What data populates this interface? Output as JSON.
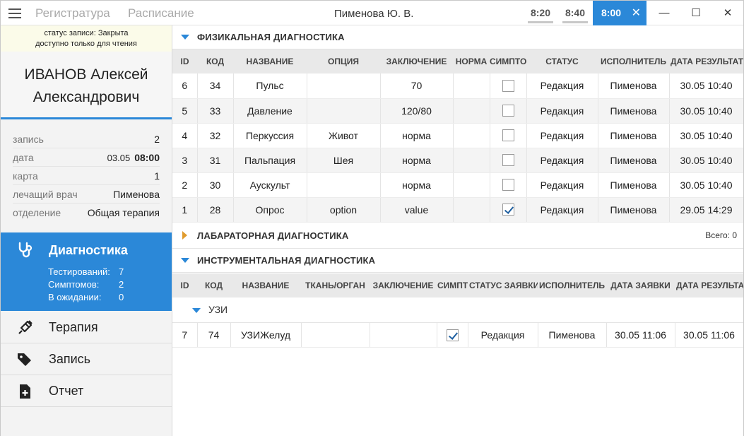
{
  "titlebar": {
    "nav": [
      "Регистратура",
      "Расписание"
    ],
    "user": "Пименова Ю. В.",
    "times": [
      "8:20",
      "8:40",
      "8:00"
    ],
    "close_tab": "✕",
    "minimize": "—",
    "maximize": "☐",
    "close": "✕"
  },
  "sidebar": {
    "status_line1": "статус записи: Закрыта",
    "status_line2": "доступно только для чтения",
    "patient_line1": "ИВАНОВ Алексей",
    "patient_line2": "Александрович",
    "info": [
      {
        "k": "запись",
        "v": "2"
      },
      {
        "k": "дата",
        "v": "03.05",
        "v2": "08:00"
      },
      {
        "k": "карта",
        "v": "1"
      },
      {
        "k": "лечащий врач",
        "v": "Пименова"
      },
      {
        "k": "отделение",
        "v": "Общая терапия"
      }
    ],
    "menu": {
      "diagnostics": "Диагностика",
      "stats": [
        {
          "l": "Тестирований:",
          "v": "7"
        },
        {
          "l": "Симптомов:",
          "v": "2"
        },
        {
          "l": "В ожидании:",
          "v": "0"
        }
      ],
      "therapy": "Терапия",
      "record": "Запись",
      "report": "Отчет"
    }
  },
  "physical": {
    "title": "ФИЗИКАЛЬНАЯ ДИАГНОСТИКА",
    "columns": [
      "ID",
      "КОД",
      "НАЗВАНИЕ",
      "ОПЦИЯ",
      "ЗАКЛЮЧЕНИЕ",
      "НОРМА",
      "СИМПТО",
      "СТАТУС",
      "ИСПОЛНИТЕЛЬ",
      "ДАТА РЕЗУЛЬТАТА"
    ],
    "rows": [
      [
        "6",
        "34",
        "Пульс",
        "",
        "70",
        "",
        false,
        "Редакция",
        "Пименова",
        "30.05 10:40"
      ],
      [
        "5",
        "33",
        "Давление",
        "",
        "120/80",
        "",
        false,
        "Редакция",
        "Пименова",
        "30.05 10:40"
      ],
      [
        "4",
        "32",
        "Перкуссия",
        "Живот",
        "норма",
        "",
        false,
        "Редакция",
        "Пименова",
        "30.05 10:40"
      ],
      [
        "3",
        "31",
        "Пальпация",
        "Шея",
        "норма",
        "",
        false,
        "Редакция",
        "Пименова",
        "30.05 10:40"
      ],
      [
        "2",
        "30",
        "Аускульт",
        "",
        "норма",
        "",
        false,
        "Редакция",
        "Пименова",
        "30.05 10:40"
      ],
      [
        "1",
        "28",
        "Опрос",
        "option",
        "value",
        "",
        true,
        "Редакция",
        "Пименова",
        "29.05 14:29"
      ]
    ]
  },
  "lab": {
    "title": "ЛАБАРАТОРНАЯ ДИАГНОСТИКА",
    "count": "Всего: 0"
  },
  "instrumental": {
    "title": "ИНСТРУМЕНТАЛЬНАЯ ДИАГНОСТИКА",
    "columns": [
      "ID",
      "КОД",
      "НАЗВАНИЕ",
      "ТКАНЬ/ОРГАН",
      "ЗАКЛЮЧЕНИЕ",
      "СИМПТО",
      "СТАТУС ЗАЯВКИ",
      "ИСПОЛНИТЕЛЬ",
      "ДАТА ЗАЯВКИ",
      "ДАТА РЕЗУЛЬТАТА"
    ],
    "group": "УЗИ",
    "rows": [
      [
        "7",
        "74",
        "УЗИЖелуд",
        "",
        "",
        true,
        "Редакция",
        "Пименова",
        "30.05 11:06",
        "30.05 11:06"
      ]
    ]
  },
  "colors": {
    "accent": "#2b88d8",
    "lab_arrow": "#e09b2d",
    "status_bg": "#fbfbe9"
  }
}
